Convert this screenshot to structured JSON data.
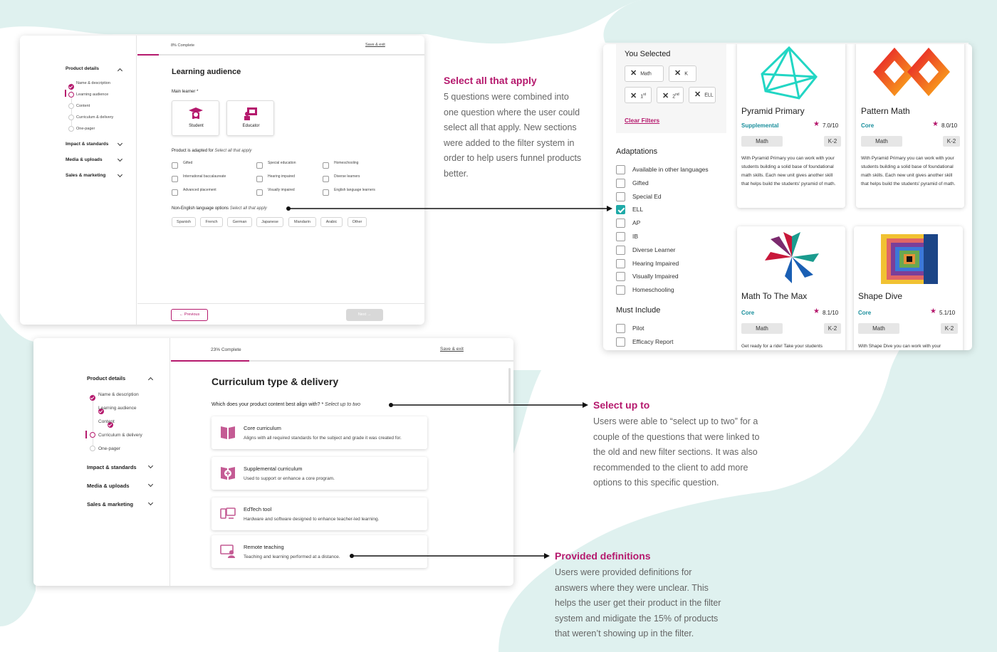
{
  "colors": {
    "accent": "#b5196d",
    "teal": "#1faaa8",
    "background_wave": "#dff1ef"
  },
  "panel1": {
    "progress": "8% Complete",
    "progress_fraction": 0.08,
    "save_exit": "Save & exit",
    "title": "Learning audience",
    "nav": {
      "product_details": "Product details",
      "steps": [
        "Name & description",
        "Learning audience",
        "Content",
        "Curriculum & delivery",
        "One-pager"
      ],
      "impact": "Impact & standards",
      "media": "Media & uploads",
      "sales": "Sales & marketing"
    },
    "main_learner_label": "Main learner",
    "main_learner_required": "*",
    "learners": [
      "Student",
      "Educator"
    ],
    "adapted_label": "Product is adapted for",
    "adapted_hint": "Select all that apply",
    "adapted_options": [
      "Gifted",
      "Special education",
      "Homeschooling",
      "International baccalaureate",
      "Hearing impaired",
      "Diverse learners",
      "Advanced placement",
      "Visually impaired",
      "English language learners"
    ],
    "language_label": "Non-English language options",
    "language_hint": "Select all that apply",
    "languages": [
      "Spanish",
      "French",
      "German",
      "Japanese",
      "Mandarin",
      "Arabic",
      "Other"
    ],
    "previous": "Previous",
    "next": "Next"
  },
  "filter_panel": {
    "you_selected": "You Selected",
    "selected_chips": [
      "Math",
      "K",
      "1st",
      "2nd",
      "ELL"
    ],
    "ordinal_base_1": "1",
    "ordinal_sup_1": "st",
    "ordinal_base_2": "2",
    "ordinal_sup_2": "nd",
    "clear_filters": "Clear Filters",
    "adaptations_title": "Adaptations",
    "adaptations": [
      {
        "label": "Available in other languages",
        "checked": false
      },
      {
        "label": "Gifted",
        "checked": false
      },
      {
        "label": "Special Ed",
        "checked": false
      },
      {
        "label": "ELL",
        "checked": true
      },
      {
        "label": "AP",
        "checked": false
      },
      {
        "label": "IB",
        "checked": false
      },
      {
        "label": "Diverse Learner",
        "checked": false
      },
      {
        "label": "Hearing Impaired",
        "checked": false
      },
      {
        "label": "Visually Impaired",
        "checked": false
      },
      {
        "label": "Homeschooling",
        "checked": false
      }
    ],
    "must_include_title": "Must Include",
    "must_include": [
      "Pilot",
      "Efficacy Report"
    ],
    "products": [
      {
        "name": "Pyramid Primary",
        "type": "Supplemental",
        "rating": "7.0/10",
        "subject": "Math",
        "grade": "K-2",
        "desc": "With Pyramid Primary you can work with your students building a solid base of foundational math skills. Each new unit gives another skill that helps build the students' pyramid of math."
      },
      {
        "name": "Pattern Math",
        "type": "Core",
        "rating": "8.0/10",
        "subject": "Math",
        "grade": "K-2",
        "desc": "With Pyramid Primary you can work with your students building a solid base of foundational math skills. Each new unit gives another skill that helps build the students' pyramid of math."
      },
      {
        "name": "Math To The Max",
        "type": "Core",
        "rating": "8.1/10",
        "subject": "Math",
        "grade": "K-2",
        "desc": "Get ready for a ride! Take your students"
      },
      {
        "name": "Shape Dive",
        "type": "Core",
        "rating": "5.1/10",
        "subject": "Math",
        "grade": "K-2",
        "desc": "With Shape Dive you can work with your"
      }
    ]
  },
  "panel2": {
    "progress": "23% Complete",
    "progress_fraction": 0.23,
    "save_exit": "Save & exit",
    "title": "Curriculum type & delivery",
    "nav": {
      "product_details": "Product details",
      "steps": [
        "Name & description",
        "Learning audience",
        "Content",
        "Curriculum & delivery",
        "One-pager"
      ],
      "impact": "Impact & standards",
      "media": "Media & uploads",
      "sales": "Sales & marketing"
    },
    "question": "Which does your product content best align with?",
    "question_required": "*",
    "question_hint": "Select up to two",
    "options": [
      {
        "title": "Core curriculum",
        "desc": "Aligns with all required standards for the subject and grade it was created for.",
        "icon": "book-icon"
      },
      {
        "title": "Supplemental curriculum",
        "desc": "Used to support or enhance a core program.",
        "icon": "book-plus-icon"
      },
      {
        "title": "EdTech tool",
        "desc": "Hardware and software designed to enhance teacher-led learning.",
        "icon": "devices-icon"
      },
      {
        "title": "Remote teaching",
        "desc": "Teaching and learning performed at a distance.",
        "icon": "remote-teacher-icon"
      }
    ]
  },
  "annotations": [
    {
      "title": "Select all that apply",
      "lines": [
        "5 questions were combined into",
        "one question where the user could",
        "select all that apply. New sections",
        "were added to the filter system in",
        "order to help users funnel products",
        "better."
      ]
    },
    {
      "title": "Select up to",
      "lines": [
        "Users were able to “select up to two” for a",
        "couple of the questions that were linked to",
        "the old and new filter sections.  It was also",
        "recommended to the client to add more",
        "options to this specific question."
      ]
    },
    {
      "title": "Provided definitions",
      "lines": [
        "Users were provided definitions for",
        "answers where they were unclear.  This",
        "helps the user get their product in the filter",
        "system and midigate the 15% of products",
        "that weren’t showing up in the filter."
      ]
    }
  ]
}
